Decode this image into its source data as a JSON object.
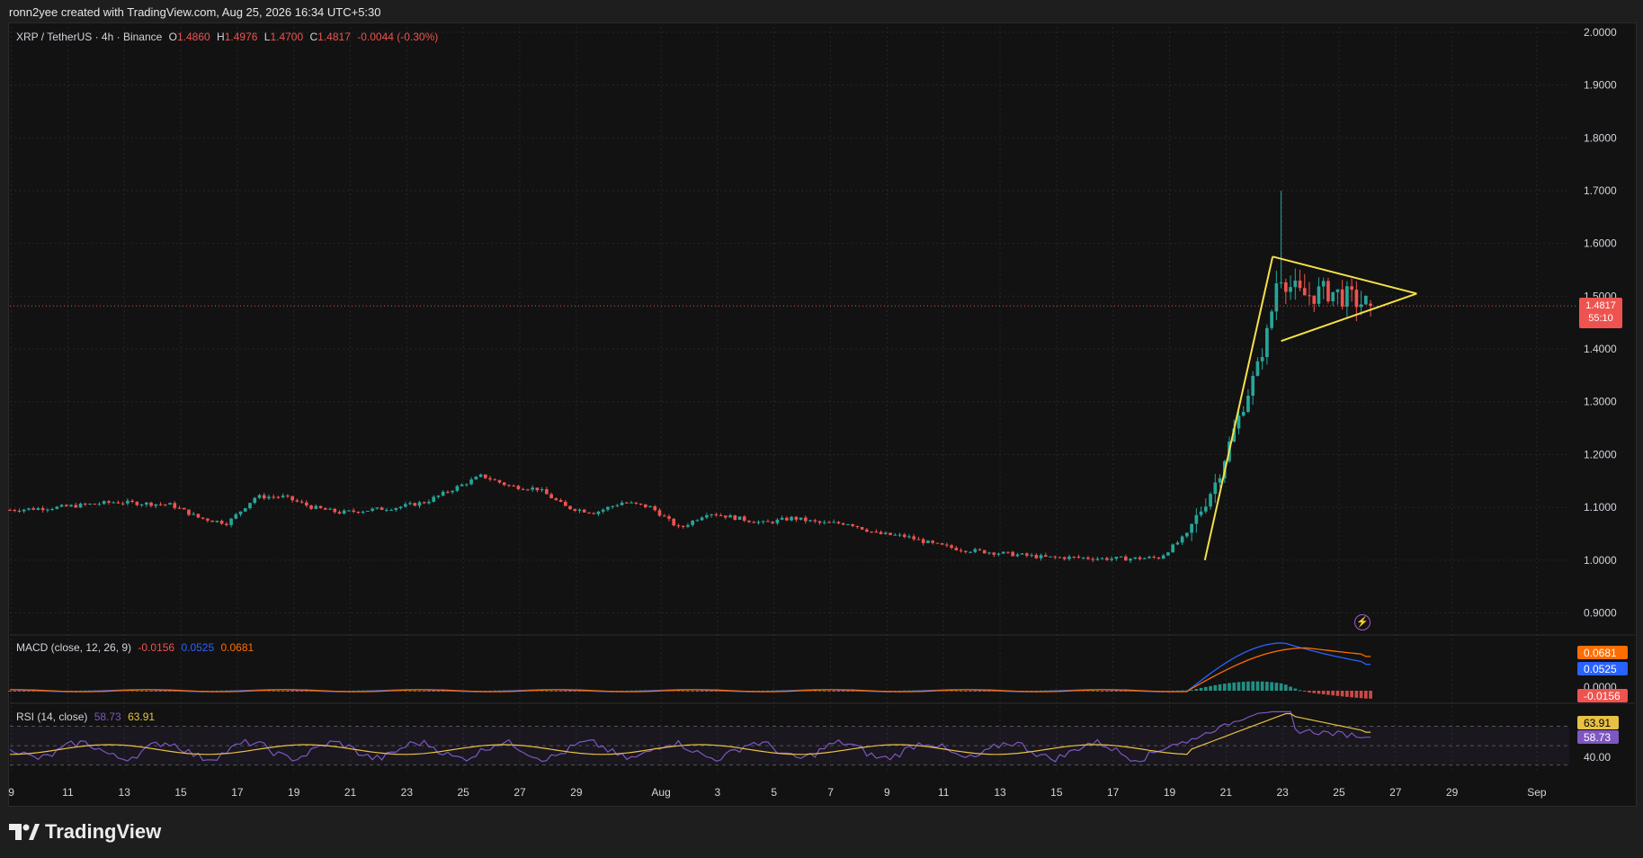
{
  "header": {
    "caption": "ronn2yee created with TradingView.com, Aug 25, 2026 16:34 UTC+5:30"
  },
  "legend": {
    "symbol": "XRP / TetherUS · 4h · Binance",
    "o_label": "O",
    "o": "1.4860",
    "h_label": "H",
    "h": "1.4976",
    "l_label": "L",
    "l": "1.4700",
    "c_label": "C",
    "c": "1.4817",
    "change": "-0.0044 (-0.30%)"
  },
  "price_tag": {
    "price": "1.4817",
    "countdown": "55:10"
  },
  "macd_legend": {
    "name": "MACD (close, 12, 26, 9)",
    "hist": "-0.0156",
    "macd": "0.0525",
    "signal": "0.0681"
  },
  "rsi_legend": {
    "name": "RSI (14, close)",
    "rsi": "58.73",
    "ma": "63.91"
  },
  "brand": {
    "name": "TradingView"
  },
  "colors": {
    "up": "#26a69a",
    "down": "#ef5350",
    "pattern": "#f5e04a",
    "macd": "#2962ff",
    "signal": "#ff6d00",
    "rsi": "#7e57c2",
    "rsi_ma": "#e8c144"
  },
  "chart_data": {
    "type": "candlestick",
    "timeframe": "4h",
    "y_axis": {
      "ticks": [
        "2.0000",
        "1.9000",
        "1.8000",
        "1.7000",
        "1.6000",
        "1.5000",
        "1.4000",
        "1.3000",
        "1.2000",
        "1.1000",
        "1.0000",
        "0.9000"
      ],
      "ylim": [
        0.86,
        2.01
      ]
    },
    "x_ticks": [
      "9",
      "11",
      "13",
      "15",
      "17",
      "19",
      "21",
      "23",
      "25",
      "27",
      "29",
      "Aug",
      "3",
      "5",
      "7",
      "9",
      "11",
      "13",
      "15",
      "17",
      "19",
      "21",
      "23",
      "25",
      "27",
      "29",
      "Sep"
    ],
    "x_range_days": [
      -22.7,
      32.5
    ],
    "close_path": [
      [
        -22.7,
        1.095
      ],
      [
        -21,
        1.1
      ],
      [
        -19,
        1.11
      ],
      [
        -17,
        1.105
      ],
      [
        -16,
        1.08
      ],
      [
        -15,
        1.07
      ],
      [
        -14,
        1.12
      ],
      [
        -13,
        1.12
      ],
      [
        -12,
        1.1
      ],
      [
        -11,
        1.09
      ],
      [
        -9,
        1.1
      ],
      [
        -8,
        1.11
      ],
      [
        -7,
        1.135
      ],
      [
        -6,
        1.16
      ],
      [
        -5,
        1.14
      ],
      [
        -4,
        1.135
      ],
      [
        -3,
        1.1
      ],
      [
        -2,
        1.09
      ],
      [
        -1,
        1.11
      ],
      [
        0,
        1.1
      ],
      [
        1,
        1.06
      ],
      [
        2,
        1.09
      ],
      [
        3,
        1.08
      ],
      [
        4,
        1.07
      ],
      [
        5,
        1.08
      ],
      [
        6,
        1.07
      ],
      [
        7,
        1.07
      ],
      [
        8,
        1.05
      ],
      [
        9,
        1.045
      ],
      [
        10,
        1.03
      ],
      [
        11,
        1.02
      ],
      [
        12,
        1.015
      ],
      [
        13,
        1.01
      ],
      [
        14,
        1.005
      ],
      [
        15,
        1.005
      ],
      [
        16,
        1.003
      ],
      [
        17,
        1.003
      ],
      [
        18,
        1.005
      ],
      [
        19,
        1.05
      ],
      [
        20,
        1.15
      ],
      [
        21,
        1.3
      ],
      [
        21.5,
        1.37
      ],
      [
        21.9,
        1.45
      ],
      [
        22.2,
        1.55
      ],
      [
        22.6,
        1.52
      ],
      [
        23,
        1.5
      ],
      [
        24,
        1.51
      ],
      [
        25,
        1.49
      ],
      [
        25.5,
        1.4817
      ]
    ],
    "spike_high": 1.7,
    "last": {
      "open": 1.486,
      "high": 1.4976,
      "low": 1.47,
      "close": 1.4817
    },
    "pattern": {
      "name": "pennant",
      "pole": [
        [
          19.6,
          1.0
        ],
        [
          22.0,
          1.575
        ]
      ],
      "upper": [
        [
          22.0,
          1.575
        ],
        [
          27.1,
          1.505
        ]
      ],
      "lower": [
        [
          22.3,
          1.415
        ],
        [
          27.1,
          1.505
        ]
      ]
    },
    "macd": {
      "ticks": [
        "0.0681",
        "0.0525",
        "0.0000",
        "-0.0156"
      ],
      "macd": 0.0525,
      "signal": 0.0681,
      "histogram": -0.0156,
      "peak_macd": 0.095,
      "peak_signal": 0.085
    },
    "rsi": {
      "ticks": [
        "63.91",
        "58.73",
        "40.00"
      ],
      "upper_band": 70,
      "lower_band": 30,
      "rsi": 58.73,
      "ma": 63.91,
      "peak": 85
    }
  }
}
